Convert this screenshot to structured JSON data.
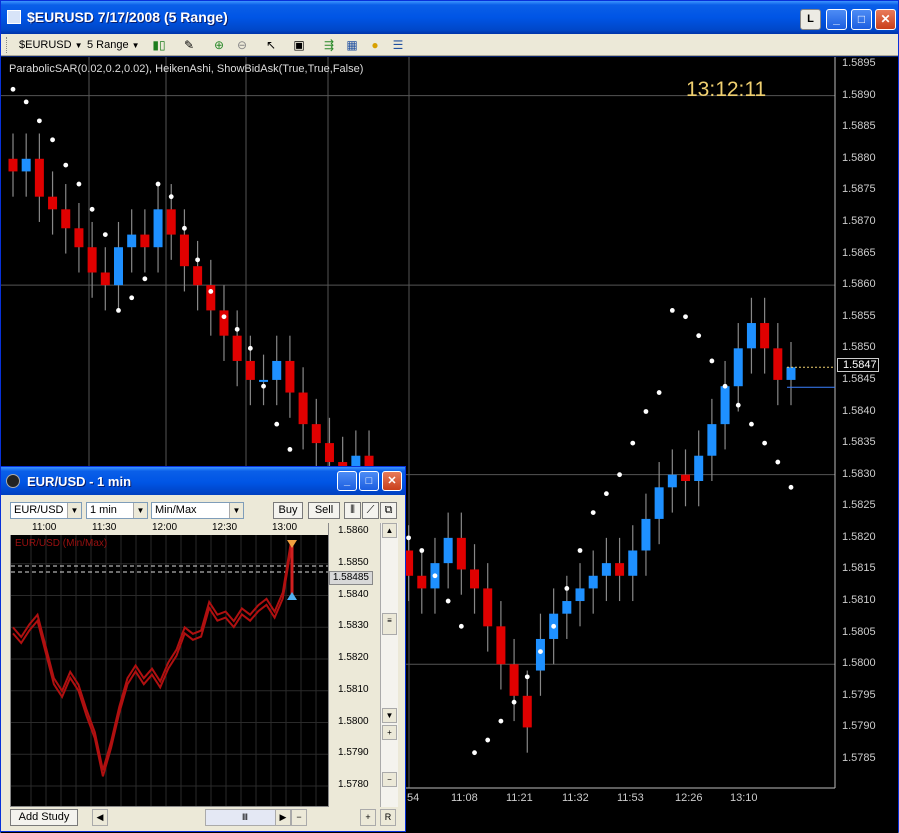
{
  "main_window": {
    "title": "$EURUSD  7/17/2008 (5 Range)",
    "btn_l": "L",
    "btn_min": "_",
    "btn_max": "□",
    "btn_close": "✕"
  },
  "toolbar": {
    "symbol": "$EURUSD",
    "interval": "5 Range",
    "icons": [
      "candle-chart-icon",
      "pencil-icon",
      "zoom-in-icon",
      "zoom-out-icon",
      "cursor-icon",
      "snapshot-icon",
      "study-icon",
      "chart-properties-icon",
      "coin-icon",
      "data-box-icon"
    ]
  },
  "chart": {
    "study_label": "ParabolicSAR(0.02,0.2,0.02), HeikenAshi, ShowBidAsk(True,True,False)",
    "clock": "13:12:11",
    "last_price": "1.5847",
    "y_ticks": [
      "1.5895",
      "1.5890",
      "1.5885",
      "1.5880",
      "1.5875",
      "1.5870",
      "1.5865",
      "1.5860",
      "1.5855",
      "1.5850",
      "1.5845",
      "1.5840",
      "1.5835",
      "1.5830",
      "1.5825",
      "1.5820",
      "1.5815",
      "1.5810",
      "1.5805",
      "1.5800",
      "1.5795",
      "1.5790",
      "1.5785"
    ],
    "x_ticks": [
      "54",
      "11:08",
      "11:21",
      "11:32",
      "11:53",
      "12:26",
      "13:10"
    ],
    "colors": {
      "up": "#1e90ff",
      "down": "#e00000",
      "sar": "#ffffff",
      "background": "#000000"
    }
  },
  "chart_data": {
    "type": "line",
    "title": "",
    "xlabel": "",
    "ylabel": "",
    "ylim": [
      1.5782,
      1.5896
    ],
    "series": [
      {
        "name": "",
        "open": [
          1.588,
          1.5878,
          1.588,
          1.5874,
          1.5872,
          1.5869,
          1.5866,
          1.5862,
          1.586,
          1.5866,
          1.5868,
          1.5866,
          1.5872,
          1.5868,
          1.5863,
          1.586,
          1.5856,
          1.5852,
          1.5848,
          1.5845,
          1.5845,
          1.5848,
          1.5843,
          1.5838,
          1.5835,
          1.5832,
          1.5828,
          1.5833,
          1.5826,
          1.5822,
          1.5818,
          1.5814,
          1.5812,
          1.5816,
          1.582,
          1.5815,
          1.5812,
          1.5806,
          1.58,
          1.5795,
          1.5799,
          1.5804,
          1.5808,
          1.581,
          1.5812,
          1.5814,
          1.5816,
          1.5814,
          1.5818,
          1.5823,
          1.5828,
          1.583,
          1.5829,
          1.5833,
          1.5838,
          1.5844,
          1.585,
          1.5854,
          1.585,
          1.5845
        ],
        "close": [
          1.5878,
          1.588,
          1.5874,
          1.5872,
          1.5869,
          1.5866,
          1.5862,
          1.586,
          1.5866,
          1.5868,
          1.5866,
          1.5872,
          1.5868,
          1.5863,
          1.586,
          1.5856,
          1.5852,
          1.5848,
          1.5845,
          1.5845,
          1.5848,
          1.5843,
          1.5838,
          1.5835,
          1.5832,
          1.5828,
          1.5833,
          1.5826,
          1.5822,
          1.5818,
          1.5814,
          1.5812,
          1.5816,
          1.582,
          1.5815,
          1.5812,
          1.5806,
          1.58,
          1.5795,
          1.579,
          1.5804,
          1.5808,
          1.581,
          1.5812,
          1.5814,
          1.5816,
          1.5814,
          1.5818,
          1.5823,
          1.5828,
          1.583,
          1.5829,
          1.5833,
          1.5838,
          1.5844,
          1.585,
          1.5854,
          1.585,
          1.5845,
          1.5847
        ],
        "sar": [
          1.5891,
          1.5889,
          1.5886,
          1.5883,
          1.5879,
          1.5876,
          1.5872,
          1.5868,
          1.5856,
          1.5858,
          1.5861,
          1.5876,
          1.5874,
          1.5869,
          1.5864,
          1.5859,
          1.5855,
          1.5853,
          1.585,
          1.5844,
          1.5838,
          1.5834,
          1.5831,
          1.5827,
          1.5823,
          1.5818,
          1.5815,
          1.581,
          1.5806,
          1.5804,
          1.582,
          1.5818,
          1.5814,
          1.581,
          1.5806,
          1.5786,
          1.5788,
          1.5791,
          1.5794,
          1.5798,
          1.5802,
          1.5806,
          1.5812,
          1.5818,
          1.5824,
          1.5827,
          1.583,
          1.5835,
          1.584,
          1.5843,
          1.5856,
          1.5855,
          1.5852,
          1.5848,
          1.5844,
          1.5841,
          1.5838,
          1.5835,
          1.5832,
          1.5828
        ]
      }
    ]
  },
  "child_window": {
    "title": "EUR/USD - 1 min",
    "symbol": "EUR/USD",
    "interval": "1 min",
    "style": "Min/Max",
    "buy_label": "Buy",
    "sell_label": "Sell",
    "study_label": "EUR/USD (Min/Max)",
    "price_tag": "1.58485",
    "add_study_label": "Add Study",
    "time_ticks": [
      "11:00",
      "11:30",
      "12:00",
      "12:30",
      "13:00"
    ],
    "y_ticks": [
      "1.5860",
      "1.5850",
      "1.5840",
      "1.5830",
      "1.5820",
      "1.5810",
      "1.5800",
      "1.5790",
      "1.5780"
    ],
    "chart_data": {
      "type": "area",
      "title": "",
      "ylim": [
        1.578,
        1.5862
      ],
      "series": [
        {
          "name": "",
          "values": [
            1.5829,
            1.5826,
            1.583,
            1.5833,
            1.5823,
            1.5813,
            1.5809,
            1.5815,
            1.5811,
            1.5803,
            1.5796,
            1.5784,
            1.5793,
            1.5804,
            1.5813,
            1.5817,
            1.5813,
            1.5816,
            1.5812,
            1.5818,
            1.5822,
            1.5829,
            1.5827,
            1.5828,
            1.5837,
            1.5833,
            1.5834,
            1.5831,
            1.5835,
            1.5833,
            1.5836,
            1.5838,
            1.5834,
            1.584,
            1.5856
          ]
        }
      ]
    }
  }
}
